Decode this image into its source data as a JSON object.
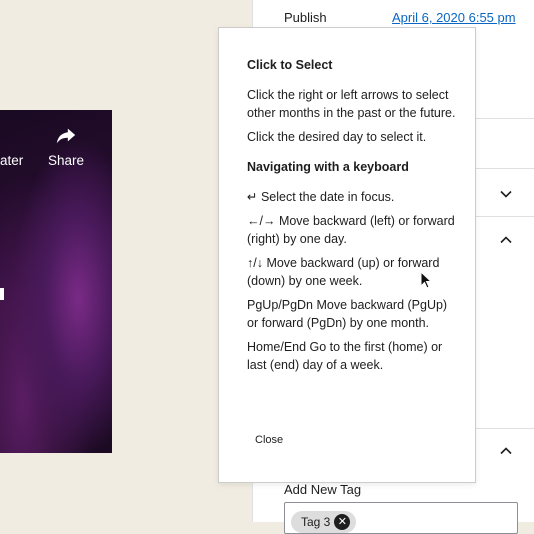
{
  "video": {
    "later_label": "ater",
    "share_label": "Share"
  },
  "sidebar": {
    "publish_label": "Publish",
    "publish_date": "April 6, 2020 6:55 pm",
    "add_new_tag_label": "Add New Tag",
    "tag_chip": "Tag 3"
  },
  "help_popover": {
    "heading_select": "Click to Select",
    "select_p1": "Click the right or left arrows to select other months in the past or the future.",
    "select_p2": "Click the desired day to select it.",
    "heading_keyboard": "Navigating with a keyboard",
    "kb_items": [
      "↵ Select the date in focus.",
      "←/→ Move backward (left) or forward (right) by one day.",
      "↑/↓ Move backward (up) or forward (down) by one week.",
      "PgUp/PgDn Move backward (PgUp) or forward (PgDn) by one month.",
      "Home/End Go to the first (home) or last (end) day of a week."
    ],
    "close_label": "Close"
  }
}
